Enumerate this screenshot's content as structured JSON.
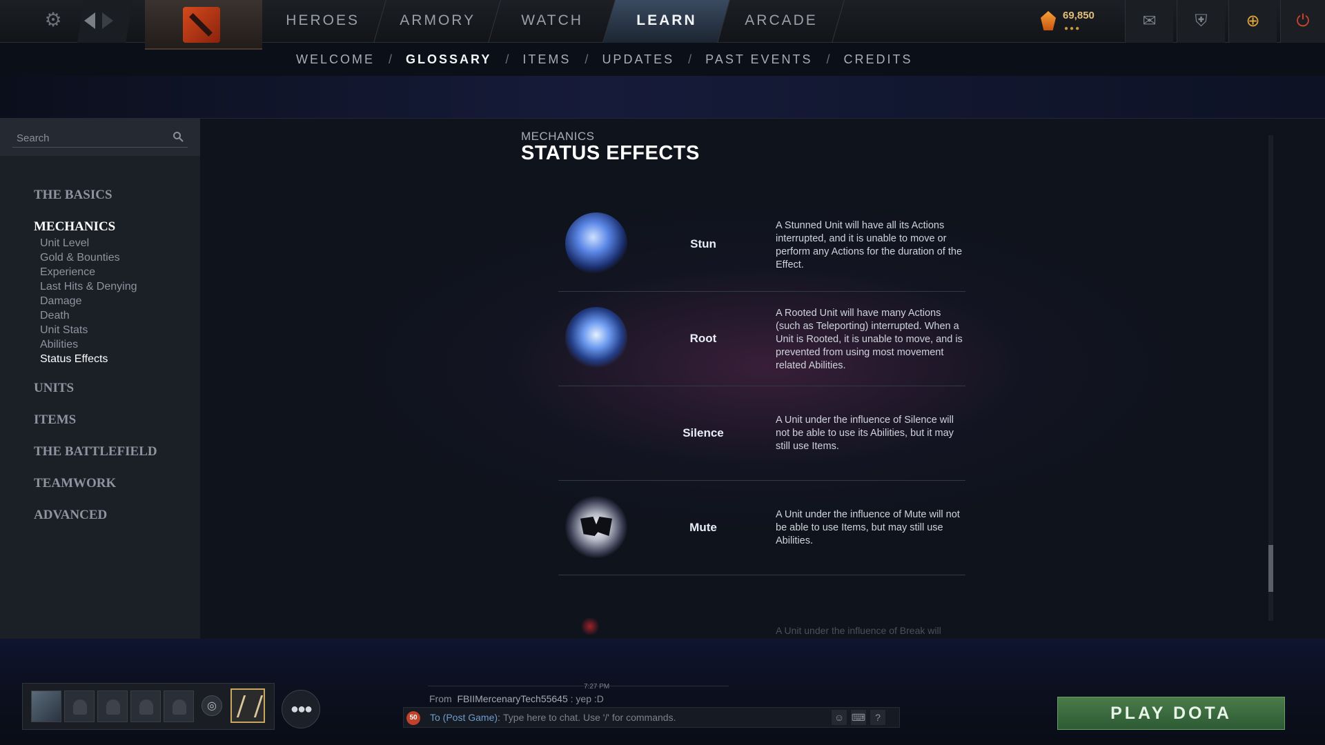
{
  "top_nav": {
    "tabs": [
      "HEROES",
      "ARMORY",
      "WATCH",
      "LEARN",
      "ARCADE"
    ],
    "active_tab": "LEARN",
    "currency_value": "69,850",
    "icons": [
      "settings-gear-icon",
      "back-arrow-icon",
      "forward-arrow-icon",
      "dota-logo-icon",
      "shard-currency-icon",
      "mail-icon",
      "armory-icon",
      "plus-icon",
      "power-icon"
    ]
  },
  "sub_nav": {
    "items": [
      "WELCOME",
      "GLOSSARY",
      "ITEMS",
      "UPDATES",
      "PAST EVENTS",
      "CREDITS"
    ],
    "separator": "/",
    "active_item": "GLOSSARY"
  },
  "sidebar": {
    "search_placeholder": "Search",
    "categories": [
      {
        "label": "THE BASICS"
      },
      {
        "label": "MECHANICS",
        "active": true,
        "subitems": [
          "Unit Level",
          "Gold & Bounties",
          "Experience",
          "Last Hits & Denying",
          "Damage",
          "Death",
          "Unit Stats",
          "Abilities",
          "Status Effects"
        ],
        "active_subitem": "Status Effects"
      },
      {
        "label": "UNITS"
      },
      {
        "label": "ITEMS"
      },
      {
        "label": "THE BATTLEFIELD"
      },
      {
        "label": "TEAMWORK"
      },
      {
        "label": "ADVANCED"
      }
    ]
  },
  "content": {
    "kicker": "MECHANICS",
    "heading": "STATUS EFFECTS",
    "effects": [
      {
        "name": "Stun",
        "icon": "stun-swirl-icon",
        "description": "A Stunned Unit will have all its Actions interrupted, and it is unable to move or perform any Actions for the duration of the Effect."
      },
      {
        "name": "Root",
        "icon": "root-icon",
        "description": "A Rooted Unit will have many Actions (such as Teleporting) interrupted. When a Unit is Rooted, it is unable to move, and is prevented from using most movement related Abilities."
      },
      {
        "name": "Silence",
        "icon": "silence-icon",
        "description": "A Unit under the influence of Silence will not be able to use its Abilities, but it may still use Items."
      },
      {
        "name": "Mute",
        "icon": "mute-icon",
        "description": "A Unit under the influence of Mute will not be able to use Items, but may still use Abilities."
      }
    ],
    "partial_row_text": "A Unit under the influence of Break will"
  },
  "bottom_bar": {
    "chat": {
      "timestamp": "7:27 PM",
      "message_prefix": "From",
      "message_sender": "FBIIMercenaryTech55645",
      "message_text": ": yep :D",
      "unread_count": "50",
      "channel_label": "To (Post Game):",
      "input_placeholder": "Type here to chat. Use '/' for commands.",
      "help_label": "?"
    },
    "play_button_label": "PLAY DOTA"
  }
}
